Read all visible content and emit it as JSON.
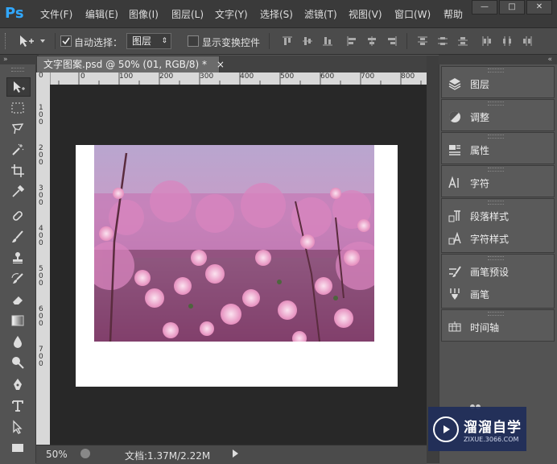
{
  "app": {
    "logo": "Ps"
  },
  "menu": [
    "文件(F)",
    "编辑(E)",
    "图像(I)",
    "图层(L)",
    "文字(Y)",
    "选择(S)",
    "滤镜(T)",
    "视图(V)",
    "窗口(W)",
    "帮助"
  ],
  "window_controls": {
    "minimize": "—",
    "maximize": "□",
    "close": "✕"
  },
  "options_bar": {
    "auto_select_label": "自动选择：",
    "auto_select_checked": true,
    "auto_select_target": "图层",
    "show_transform_label": "显示变换控件",
    "show_transform_checked": false
  },
  "document": {
    "tab_title": "文字图案.psd @ 50% (01, RGB/8) *",
    "close_symbol": "×",
    "ruler_h": [
      "0",
      "100",
      "200",
      "300",
      "400",
      "500",
      "600",
      "700",
      "800"
    ],
    "ruler_v": [
      "0",
      "1\n0\n0",
      "2\n0\n0",
      "3\n0\n0",
      "4\n0\n0",
      "5\n0\n0",
      "6\n0\n0",
      "7\n0\n0"
    ]
  },
  "status": {
    "zoom": "50%",
    "doc_info": "文档:1.37M/2.22M"
  },
  "panels": [
    {
      "group": 1,
      "items": [
        {
          "label": "图层",
          "icon": "layers-icon"
        }
      ]
    },
    {
      "group": 2,
      "items": [
        {
          "label": "调整",
          "icon": "adjustments-icon"
        }
      ]
    },
    {
      "group": 3,
      "items": [
        {
          "label": "属性",
          "icon": "properties-icon"
        }
      ]
    },
    {
      "group": 4,
      "items": [
        {
          "label": "字符",
          "icon": "character-icon"
        }
      ]
    },
    {
      "group": 5,
      "items": [
        {
          "label": "段落样式",
          "icon": "paragraph-styles-icon"
        },
        {
          "label": "字符样式",
          "icon": "character-styles-icon"
        }
      ]
    },
    {
      "group": 6,
      "items": [
        {
          "label": "画笔预设",
          "icon": "brush-presets-icon"
        },
        {
          "label": "画笔",
          "icon": "brush-icon"
        }
      ]
    },
    {
      "group": 7,
      "items": [
        {
          "label": "时间轴",
          "icon": "timeline-icon"
        }
      ]
    }
  ],
  "watermark": {
    "title": "溜溜自学",
    "subtitle": "ZIXUE.3066.COM"
  },
  "colors": {
    "ps_blue": "#31a8ff",
    "ui_dark": "#3a3a3a",
    "panel_bg": "#535353",
    "canvas_bg": "#282828"
  }
}
